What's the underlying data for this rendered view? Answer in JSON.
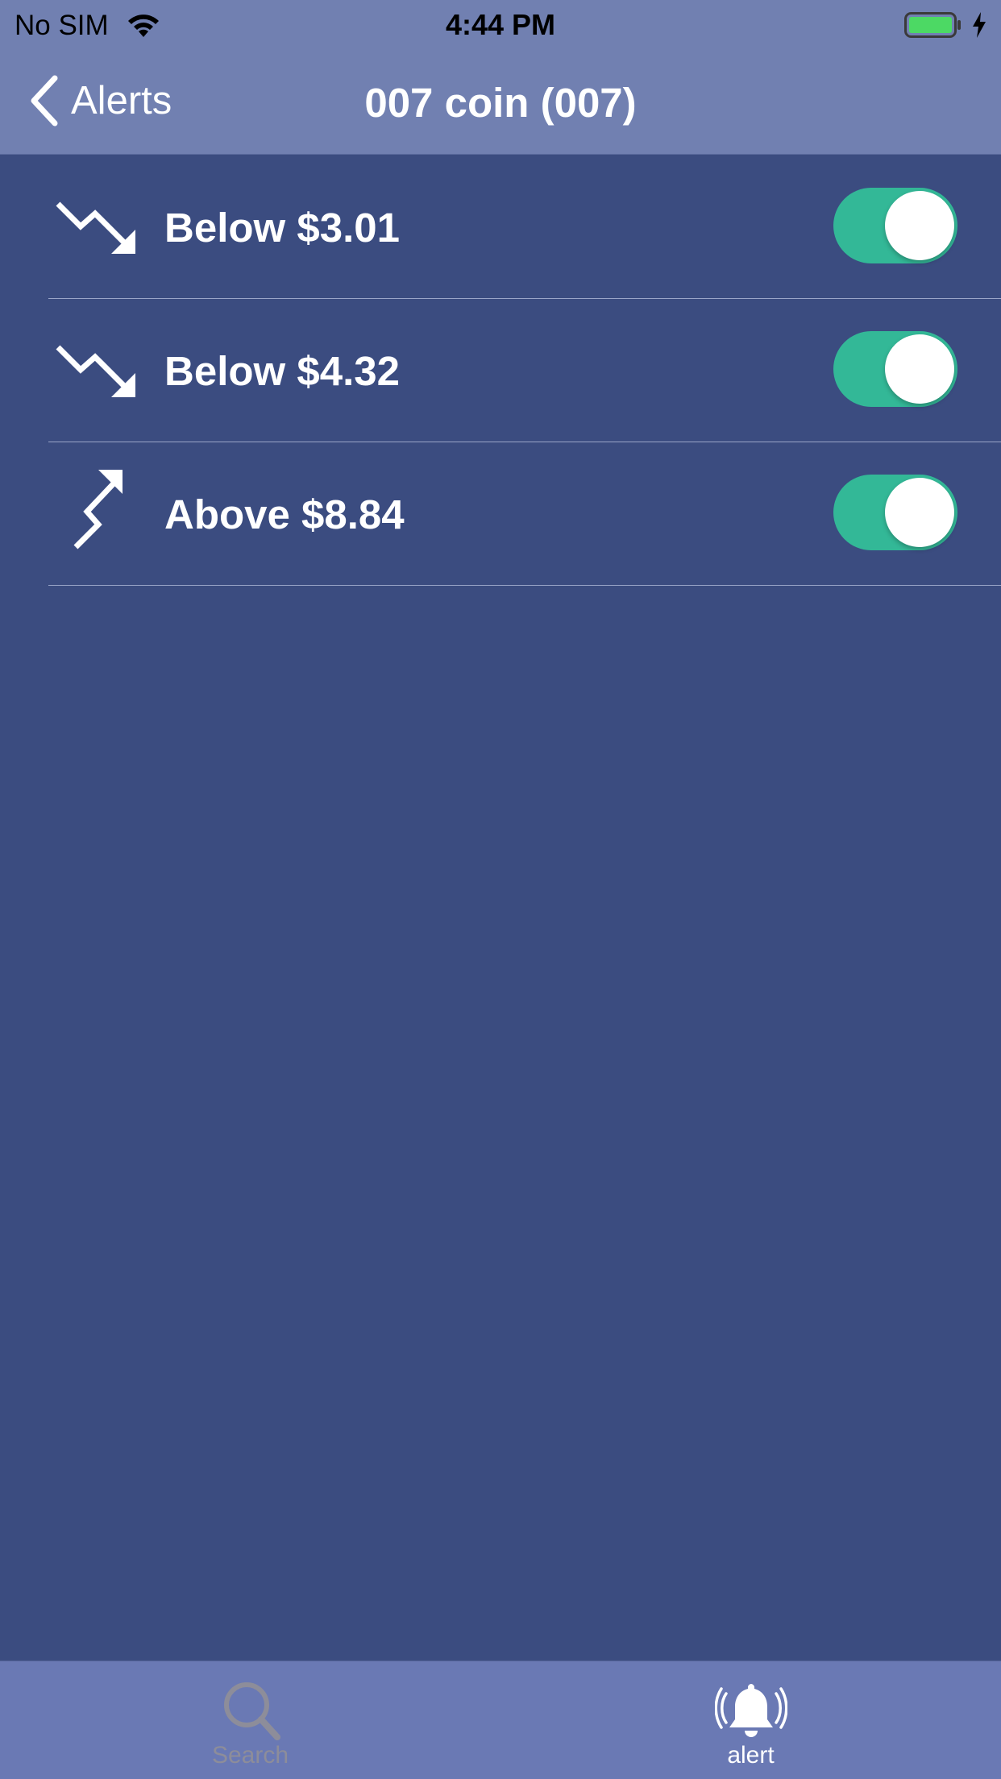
{
  "status_bar": {
    "carrier": "No SIM",
    "time": "4:44 PM",
    "icons": [
      "wifi-icon",
      "battery-icon",
      "charging-bolt-icon"
    ],
    "battery_color": "#4cd964"
  },
  "nav": {
    "back_label": "Alerts",
    "title": "007 coin (007)"
  },
  "alerts": [
    {
      "direction": "below",
      "icon": "trend-down-icon",
      "label": "Below $3.01",
      "enabled": true
    },
    {
      "direction": "below",
      "icon": "trend-down-icon",
      "label": "Below $4.32",
      "enabled": true
    },
    {
      "direction": "above",
      "icon": "trend-up-icon",
      "label": "Above $8.84",
      "enabled": true
    }
  ],
  "tab_bar": {
    "tabs": [
      {
        "label": "Search",
        "icon": "search-icon",
        "selected": false
      },
      {
        "label": "alert",
        "icon": "bell-ringing-icon",
        "selected": true
      }
    ]
  },
  "colors": {
    "header_bg": "#7180b1",
    "content_bg": "#3b4c80",
    "toggle_on": "#33b897",
    "tab_bar_bg": "#6a79b4"
  }
}
